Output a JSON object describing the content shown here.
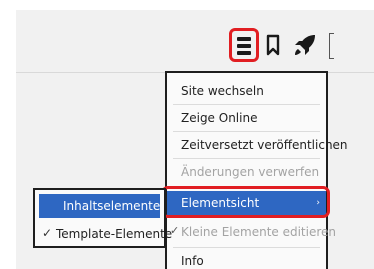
{
  "toolbar": {
    "menu_icon": "hamburger-menu-icon",
    "bookmark_icon": "bookmark-icon",
    "rocket_icon": "rocket-icon"
  },
  "menu": {
    "items": [
      {
        "label": "Site wechseln",
        "disabled": false
      },
      {
        "label": "Zeige Online",
        "disabled": false
      },
      {
        "label": "Zeitversetzt veröffentlichen",
        "disabled": false
      },
      {
        "label": "Änderungen verwerfen",
        "disabled": true
      },
      {
        "label": "Elementsicht",
        "active": true,
        "has_submenu": true
      },
      {
        "label": "Kleine Elemente editieren",
        "disabled": true,
        "checked": true
      },
      {
        "label": "Info",
        "disabled": false
      }
    ],
    "submenu_chevron": "›",
    "check_mark": "✓"
  },
  "submenu": {
    "items": [
      {
        "label": "Inhaltselemente",
        "active": true
      },
      {
        "label": "Template-Elemente",
        "checked": true
      }
    ],
    "check_mark": "✓"
  },
  "colors": {
    "highlight": "#e11e22",
    "selection": "#2e67c2"
  }
}
